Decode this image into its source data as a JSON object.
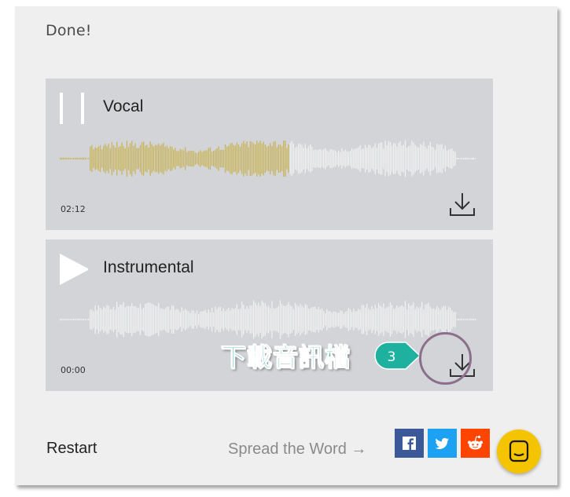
{
  "status": {
    "text": "Done!"
  },
  "tracks": [
    {
      "title": "Vocal",
      "time": "02:12",
      "state": "playing",
      "progress": 0.55
    },
    {
      "title": "Instrumental",
      "time": "00:00",
      "state": "paused",
      "progress": 0
    }
  ],
  "annotation": {
    "label": "下載音訊檔",
    "step": "3"
  },
  "footer": {
    "restart": "Restart",
    "spread": "Spread the Word →"
  },
  "share": [
    {
      "icon": "facebook-icon",
      "color": "#3b5998"
    },
    {
      "icon": "twitter-icon",
      "color": "#1da1f2"
    },
    {
      "icon": "reddit-icon",
      "color": "#ff4500"
    }
  ],
  "colors": {
    "waveform_played": "#c9b356",
    "waveform_unplayed": "#f2f2f2",
    "annotation": "#1fb1a0",
    "chat": "#f5c400"
  }
}
